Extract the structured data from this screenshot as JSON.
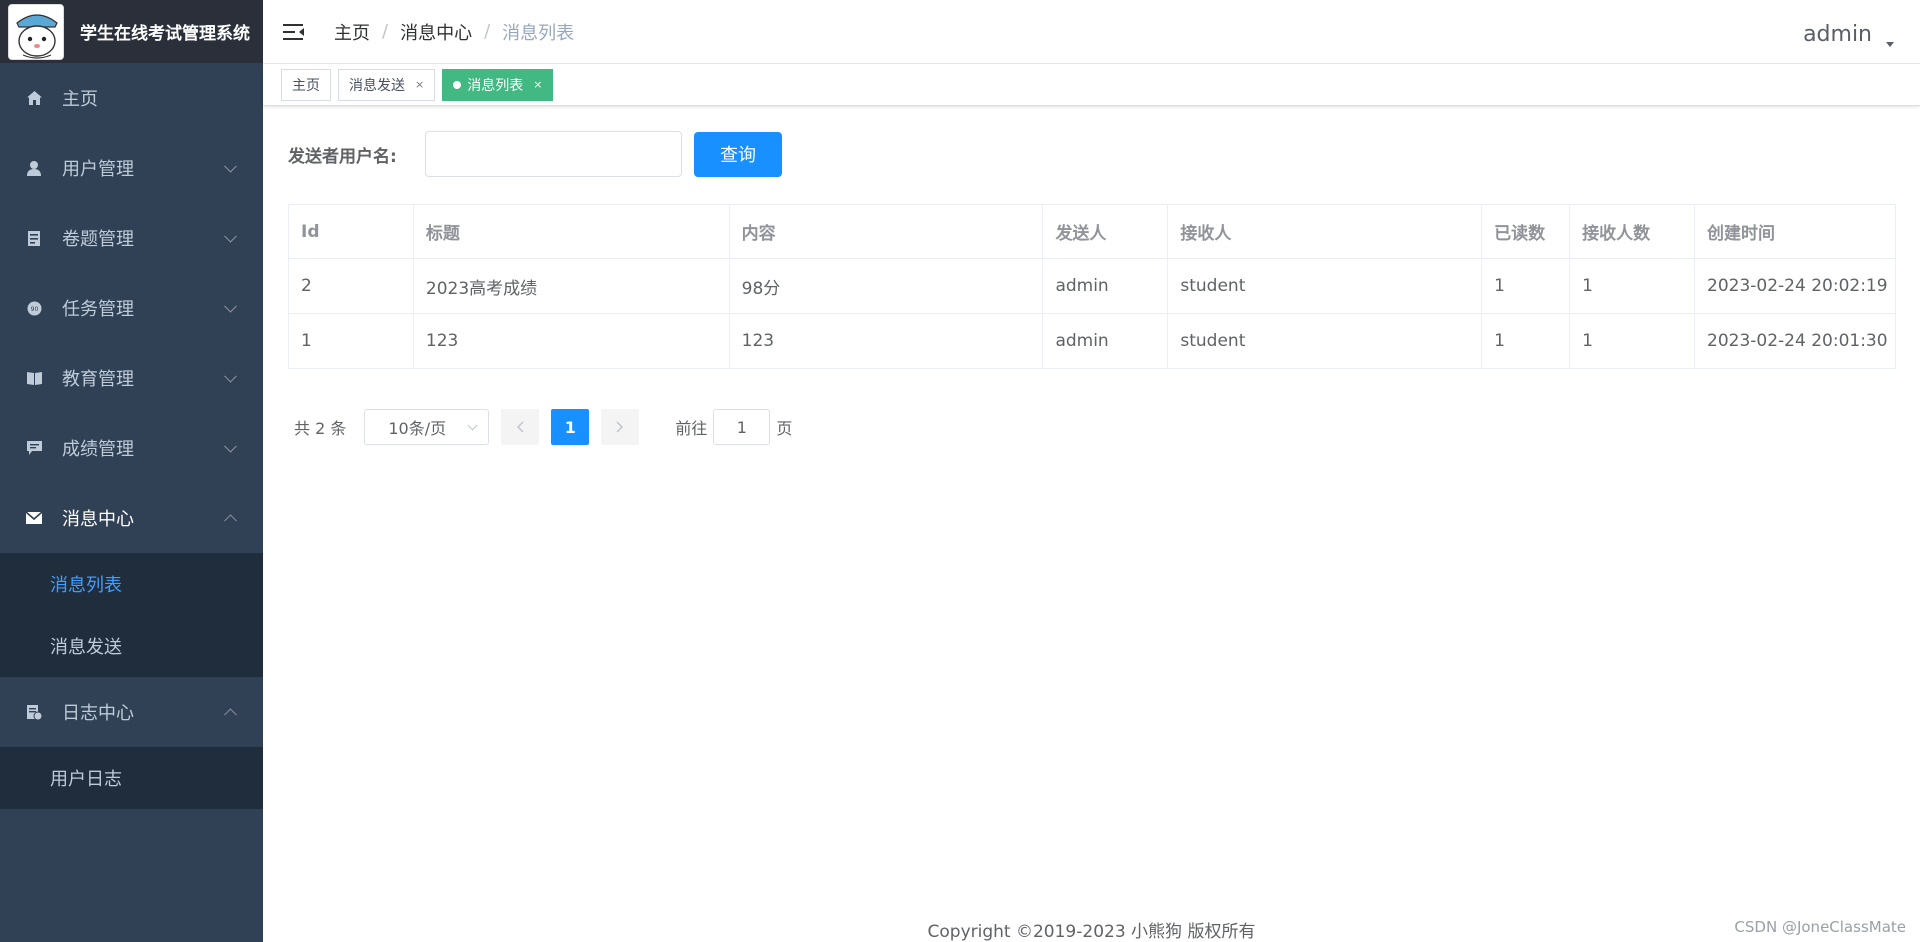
{
  "app": {
    "title": "学生在线考试管理系统"
  },
  "sidebar": {
    "items": [
      {
        "label": "主页",
        "icon": "home-icon"
      },
      {
        "label": "用户管理",
        "icon": "user-icon"
      },
      {
        "label": "卷题管理",
        "icon": "paper-icon"
      },
      {
        "label": "任务管理",
        "icon": "task-icon"
      },
      {
        "label": "教育管理",
        "icon": "book-icon"
      },
      {
        "label": "成绩管理",
        "icon": "chat-icon"
      },
      {
        "label": "消息中心",
        "icon": "mail-icon",
        "children": [
          "消息列表",
          "消息发送"
        ]
      },
      {
        "label": "日志中心",
        "icon": "log-icon",
        "children": [
          "用户日志"
        ]
      }
    ]
  },
  "header": {
    "breadcrumb": [
      "主页",
      "消息中心",
      "消息列表"
    ],
    "breadcrumb_sep": "/",
    "user": "admin"
  },
  "tags": [
    {
      "label": "主页"
    },
    {
      "label": "消息发送",
      "close": "×"
    },
    {
      "label": "消息列表",
      "close": "×"
    }
  ],
  "search": {
    "label": "发送者用户名:",
    "value": "",
    "button": "查询"
  },
  "table": {
    "headers": [
      "Id",
      "标题",
      "内容",
      "发送人",
      "接收人",
      "已读数",
      "接收人数",
      "创建时间"
    ],
    "rows": [
      [
        "2",
        "2023高考成绩",
        "98分",
        "admin",
        "student",
        "1",
        "1",
        "2023-02-24 20:02:19"
      ],
      [
        "1",
        "123",
        "123",
        "admin",
        "student",
        "1",
        "1",
        "2023-02-24 20:01:30"
      ]
    ]
  },
  "pagination": {
    "total_text": "共 2 条",
    "page_size": "10条/页",
    "current_page": "1",
    "goto_prefix": "前往",
    "goto_value": "1",
    "goto_suffix": "页"
  },
  "footer": {
    "copyright": "Copyright ©2019-2023 小熊狗 版权所有"
  },
  "watermark": "CSDN @JoneClassMate",
  "colors": {
    "sidebar_bg": "#304156",
    "brand_bg": "#2b2f3a",
    "submenu_bg": "#1f2d3d",
    "active_link": "#409eff",
    "active_tag": "#42b983",
    "primary_button": "#1890ff"
  }
}
